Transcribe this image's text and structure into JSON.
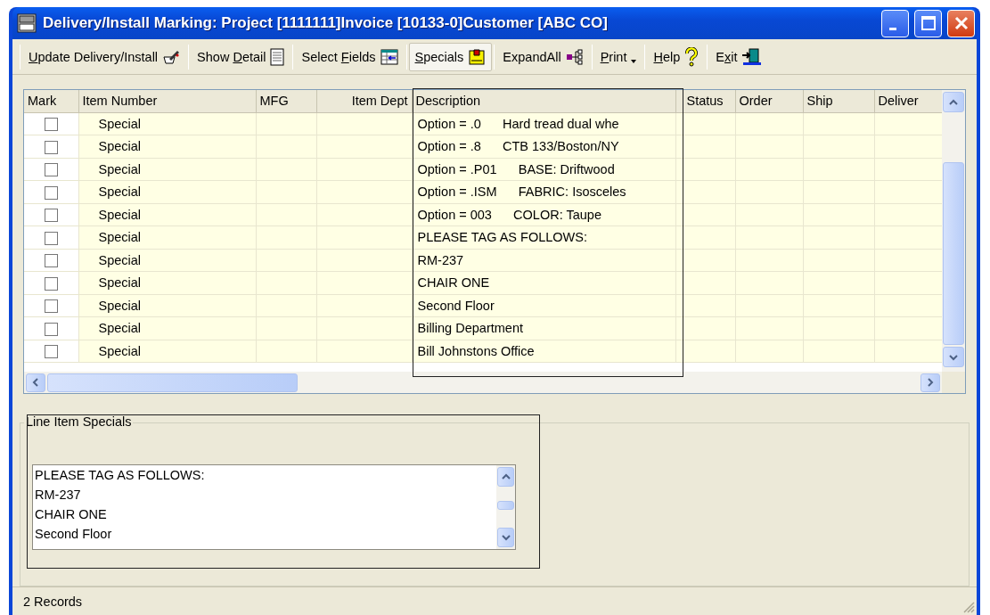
{
  "window": {
    "title": "Delivery/Install Marking: Project [1111111]Invoice [10133-0]Customer [ABC CO]"
  },
  "toolbar": [
    {
      "access_key": "U",
      "label_rest": "pdate Delivery/Install",
      "selected": false
    },
    {
      "label": "Show ",
      "access_key": "D",
      "label_rest": "etail",
      "selected": false
    },
    {
      "label": "Select ",
      "access_key": "F",
      "label_rest": "ields",
      "selected": false
    },
    {
      "access_key": "S",
      "label_rest": "pecials",
      "selected": true
    },
    {
      "label": "ExpandAll",
      "selected": false
    },
    {
      "access_key": "P",
      "label_rest": "rint",
      "selected": false
    },
    {
      "access_key": "H",
      "label_rest": "elp",
      "selected": false
    },
    {
      "label": "E",
      "access_key": "x",
      "label_rest": "it",
      "selected": false
    }
  ],
  "table": {
    "columns": [
      "Mark",
      "Item Number",
      "MFG",
      "Item Dept",
      "Description",
      "Status",
      "Order",
      "Ship",
      "Deliver"
    ],
    "rows": [
      {
        "checked": false,
        "item_number": "Special",
        "description": "Option = .0      Hard tread dual whe"
      },
      {
        "checked": false,
        "item_number": "Special",
        "description": "Option = .8      CTB 133/Boston/NY"
      },
      {
        "checked": false,
        "item_number": "Special",
        "description": "Option = .P01      BASE: Driftwood"
      },
      {
        "checked": false,
        "item_number": "Special",
        "description": "Option = .ISM      FABRIC: Isosceles"
      },
      {
        "checked": false,
        "item_number": "Special",
        "description": "Option = 003      COLOR: Taupe"
      },
      {
        "checked": false,
        "item_number": "Special",
        "description": "PLEASE TAG AS FOLLOWS:"
      },
      {
        "checked": false,
        "item_number": "Special",
        "description": "RM-237"
      },
      {
        "checked": false,
        "item_number": "Special",
        "description": "CHAIR ONE"
      },
      {
        "checked": false,
        "item_number": "Special",
        "description": "Second Floor"
      },
      {
        "checked": false,
        "item_number": "Special",
        "description": "Billing Department"
      },
      {
        "checked": false,
        "item_number": "Special",
        "description": "Bill Johnstons Office"
      }
    ]
  },
  "specials_panel": {
    "title": "Line Item Specials",
    "text": "PLEASE TAG AS FOLLOWS:\nRM-237\nCHAIR ONE\nSecond Floor"
  },
  "status_bar": {
    "text": "2 Records"
  }
}
